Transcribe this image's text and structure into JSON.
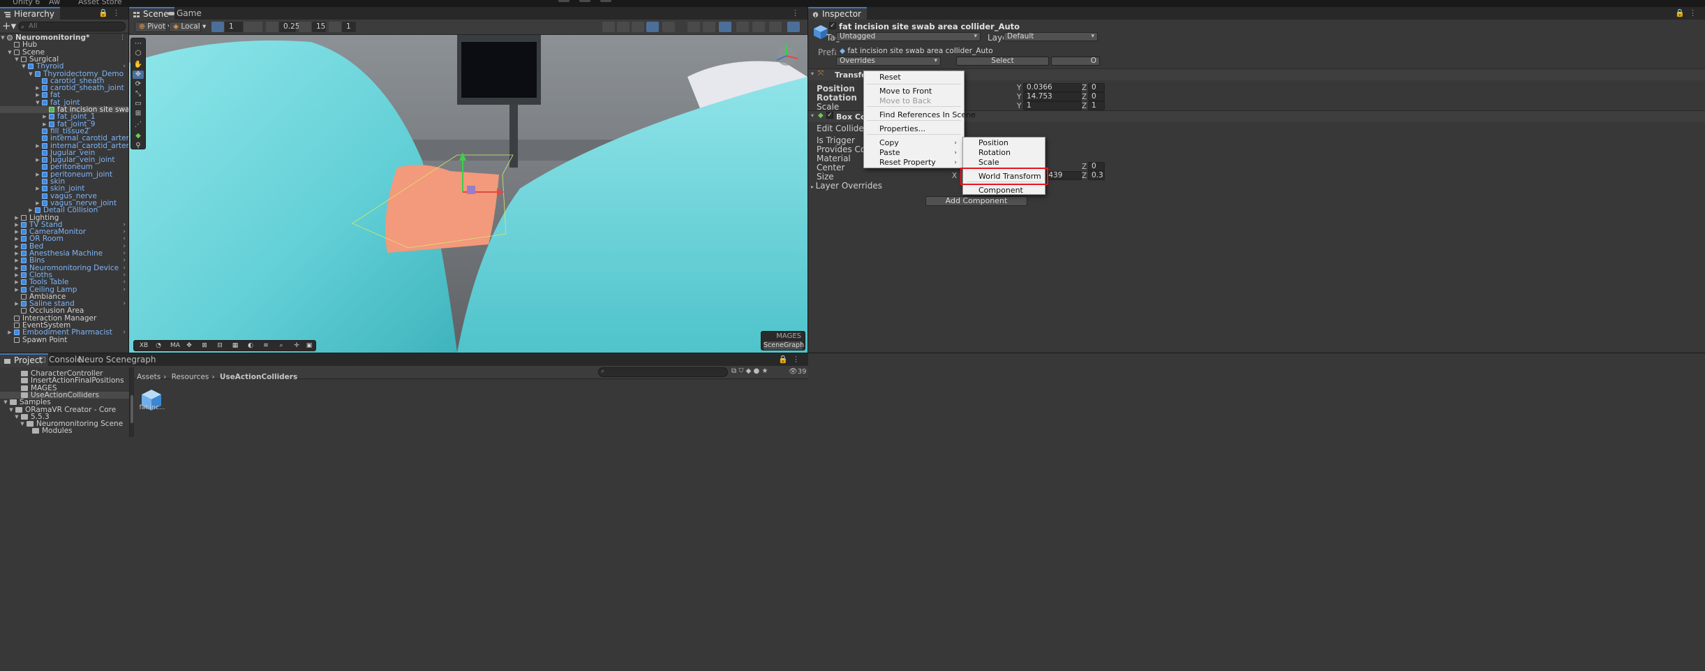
{
  "topbar": {
    "items": [
      "Unity 6",
      "Aw",
      "Asset Store"
    ]
  },
  "hierarchy": {
    "tab_label": "Hierarchy",
    "search_placeholder": "All",
    "rows": [
      {
        "label": "Neuromonitoring*",
        "depth": 0,
        "expanded": true,
        "kind": "scene",
        "more": true
      },
      {
        "label": "Hub",
        "depth": 1,
        "kind": "go"
      },
      {
        "label": "Scene",
        "depth": 1,
        "expanded": true,
        "kind": "go"
      },
      {
        "label": "Surgical",
        "depth": 2,
        "expanded": true,
        "kind": "go"
      },
      {
        "label": "Thyroid",
        "depth": 3,
        "expanded": true,
        "kind": "prefab",
        "more": true
      },
      {
        "label": "Thyroidectomy_Demo",
        "depth": 4,
        "expanded": true,
        "kind": "prefab"
      },
      {
        "label": "carotid_sheath",
        "depth": 5,
        "kind": "prefab"
      },
      {
        "label": "carotid_sheath_joint",
        "depth": 5,
        "collapsed": true,
        "kind": "prefab"
      },
      {
        "label": "fat",
        "depth": 5,
        "collapsed": true,
        "kind": "prefab"
      },
      {
        "label": "fat_joint",
        "depth": 5,
        "expanded": true,
        "kind": "prefab"
      },
      {
        "label": "fat incision site swab a",
        "depth": 6,
        "kind": "prefab-green",
        "selected": true,
        "more": true
      },
      {
        "label": "fat_joint_1",
        "depth": 6,
        "collapsed": true,
        "kind": "prefab"
      },
      {
        "label": "fat_joint_9",
        "depth": 6,
        "collapsed": true,
        "kind": "prefab"
      },
      {
        "label": "fill_tissue2",
        "depth": 5,
        "kind": "prefab"
      },
      {
        "label": "internal_carotid_artery",
        "depth": 5,
        "kind": "prefab"
      },
      {
        "label": "internal_carotid_artery_joint",
        "depth": 5,
        "collapsed": true,
        "kind": "prefab"
      },
      {
        "label": "Jugular_vein",
        "depth": 5,
        "kind": "prefab"
      },
      {
        "label": "Jugular_vein_joint",
        "depth": 5,
        "collapsed": true,
        "kind": "prefab"
      },
      {
        "label": "peritoneum",
        "depth": 5,
        "kind": "prefab"
      },
      {
        "label": "peritoneum_joint",
        "depth": 5,
        "collapsed": true,
        "kind": "prefab"
      },
      {
        "label": "skin",
        "depth": 5,
        "kind": "prefab"
      },
      {
        "label": "skin_joint",
        "depth": 5,
        "collapsed": true,
        "kind": "prefab"
      },
      {
        "label": "vagus_nerve",
        "depth": 5,
        "kind": "prefab"
      },
      {
        "label": "vagus_nerve_joint",
        "depth": 5,
        "collapsed": true,
        "kind": "prefab"
      },
      {
        "label": "Detail Collision",
        "depth": 4,
        "collapsed": true,
        "kind": "prefab"
      },
      {
        "label": "Lighting",
        "depth": 2,
        "collapsed": true,
        "kind": "go"
      },
      {
        "label": "TV Stand",
        "depth": 2,
        "collapsed": true,
        "kind": "prefab",
        "more": true
      },
      {
        "label": "CameraMonitor",
        "depth": 2,
        "collapsed": true,
        "kind": "prefab",
        "more": true
      },
      {
        "label": "OR Room",
        "depth": 2,
        "collapsed": true,
        "kind": "prefab",
        "more": true
      },
      {
        "label": "Bed",
        "depth": 2,
        "collapsed": true,
        "kind": "prefab",
        "more": true
      },
      {
        "label": "Anesthesia Machine",
        "depth": 2,
        "collapsed": true,
        "kind": "prefab",
        "more": true
      },
      {
        "label": "Bins",
        "depth": 2,
        "collapsed": true,
        "kind": "prefab",
        "more": true
      },
      {
        "label": "Neuromonitoring Device",
        "depth": 2,
        "collapsed": true,
        "kind": "prefab",
        "more": true
      },
      {
        "label": "Cloths",
        "depth": 2,
        "collapsed": true,
        "kind": "prefab",
        "more": true
      },
      {
        "label": "Tools Table",
        "depth": 2,
        "collapsed": true,
        "kind": "prefab",
        "more": true
      },
      {
        "label": "Ceiling Lamp",
        "depth": 2,
        "collapsed": true,
        "kind": "prefab",
        "more": true
      },
      {
        "label": "Ambiance",
        "depth": 2,
        "kind": "go"
      },
      {
        "label": "Saline stand",
        "depth": 2,
        "collapsed": true,
        "kind": "prefab",
        "more": true
      },
      {
        "label": "Occlusion Area",
        "depth": 2,
        "kind": "go"
      },
      {
        "label": "Interaction Manager",
        "depth": 1,
        "kind": "go"
      },
      {
        "label": "EventSystem",
        "depth": 1,
        "kind": "go"
      },
      {
        "label": "Embodiment Pharmacist",
        "depth": 1,
        "collapsed": true,
        "kind": "prefab",
        "more": true
      },
      {
        "label": "Spawn Point",
        "depth": 1,
        "kind": "go"
      }
    ]
  },
  "scene": {
    "tabs": [
      {
        "label": "Scene",
        "active": true
      },
      {
        "label": "Game",
        "active": false
      }
    ],
    "pivot_label": "Pivot",
    "space_label": "Local",
    "grid_value": "1",
    "snap_value": "0.25",
    "angle_value": "15",
    "scale_snap_value": "1",
    "bottom_tools": [
      "XB",
      "MA"
    ],
    "overlay_title": "MAGES",
    "overlay_button": "SceneGraph"
  },
  "inspector": {
    "tab_label": "Inspector",
    "object_name": "fat incision site swab area collider_Auto",
    "tag_label": "Tag",
    "tag_value": "Untagged",
    "layer_label": "Layer",
    "layer_value": "Default",
    "prefab_label": "Prefab",
    "prefab_value": "fat incision site swab area collider_Auto",
    "overrides_label": "Overrides",
    "select_label": "Select",
    "open_label": "O",
    "transform": {
      "title": "Transform",
      "position_label": "Position",
      "rotation_label": "Rotation",
      "scale_label": "Scale",
      "position_y": "0.0366",
      "rotation_y": "14.753",
      "scale_y": "1",
      "position_z": "0",
      "rotation_z": "0",
      "scale_z": "1"
    },
    "box_collider": {
      "title": "Box Collide",
      "edit_collider": "Edit Collider",
      "is_trigger": "Is Trigger",
      "provides_contacts": "Provides Contacts",
      "material": "Material",
      "center": "Center",
      "size": "Size",
      "size_x_partial": ".439",
      "center_z": "0",
      "size_z": "0.3"
    },
    "layer_overrides": "Layer Overrides",
    "add_component": "Add Component"
  },
  "axes": {
    "x": "X",
    "y": "Y",
    "z": "Z"
  },
  "context_menu": {
    "items": [
      {
        "label": "Reset",
        "enabled": true
      },
      {
        "label": "Move to Front",
        "enabled": true
      },
      {
        "label": "Move to Back",
        "enabled": false
      },
      {
        "label": "Find References In Scene",
        "enabled": true
      },
      {
        "label": "Properties...",
        "enabled": true
      },
      {
        "label": "Copy",
        "enabled": true,
        "submenu": true
      },
      {
        "label": "Paste",
        "enabled": true,
        "submenu": true
      },
      {
        "label": "Reset Property",
        "enabled": true,
        "submenu": true
      }
    ]
  },
  "copy_submenu": {
    "items": [
      {
        "label": "Position"
      },
      {
        "label": "Rotation"
      },
      {
        "label": "Scale"
      },
      {
        "label": "World Transform",
        "highlighted": true
      },
      {
        "label": "Component"
      }
    ]
  },
  "project": {
    "tabs": [
      {
        "label": "Project",
        "active": true
      },
      {
        "label": "Console",
        "active": false
      },
      {
        "label": "Neuro Scenegraph",
        "active": false
      }
    ],
    "tree": [
      {
        "label": "CharacterController",
        "depth": 2
      },
      {
        "label": "InsertActionFinalPositions",
        "depth": 2
      },
      {
        "label": "MAGES",
        "depth": 2
      },
      {
        "label": "UseActionColliders",
        "depth": 2,
        "selected": true
      },
      {
        "label": "Samples",
        "depth": 0,
        "expanded": true
      },
      {
        "label": "ORamaVR Creator - Core",
        "depth": 1,
        "expanded": true
      },
      {
        "label": "5.5.3",
        "depth": 2,
        "expanded": true
      },
      {
        "label": "Neuromonitoring Scene",
        "depth": 3,
        "expanded": true
      },
      {
        "label": "Modules",
        "depth": 4
      }
    ],
    "breadcrumb": [
      "Assets",
      "Resources",
      "UseActionColliders"
    ],
    "asset_label": "fat inc...",
    "count": "39"
  },
  "colors": {
    "prefab_blue": "#7fb4f5",
    "selection_blue": "#3a79bb",
    "highlight_red": "#e5151d",
    "drape_cyan": "#79dfe4",
    "tissue_salmon": "#f49a7e"
  }
}
